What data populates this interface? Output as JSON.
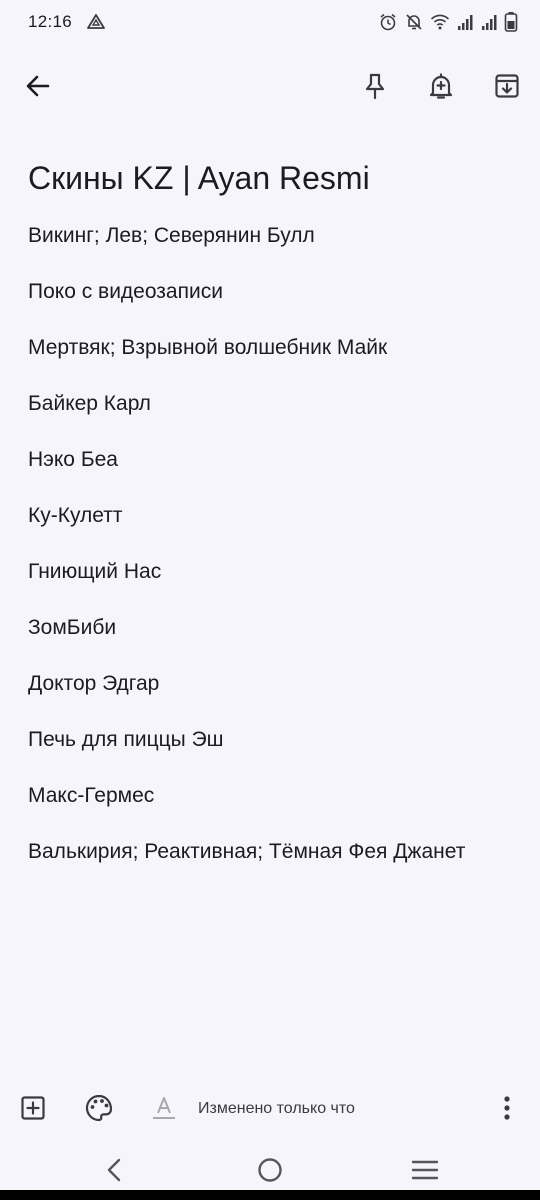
{
  "status_bar": {
    "time": "12:16",
    "icons": [
      "drive-icon",
      "alarm-icon",
      "dnd-off-icon",
      "wifi-icon",
      "signal-icon",
      "signal-icon",
      "battery-icon"
    ]
  },
  "toolbar": {
    "icons": [
      "back-arrow-icon",
      "pin-icon",
      "reminder-bell-icon",
      "archive-icon"
    ]
  },
  "note": {
    "title": "Скины KZ | Ayan Resmi",
    "lines": [
      "Викинг; Лев; Северянин Булл",
      "Поко с видеозаписи",
      "Мертвяк; Взрывной волшебник Майк",
      "Байкер Карл",
      "Нэко Беа",
      "Ку-Кулетт",
      "Гниющий Нас",
      "ЗомБиби",
      "Доктор Эдгар",
      "Печь для пиццы Эш",
      "Макс-Гермес",
      "Валькирия; Реактивная; Тёмная Фея Джанет"
    ]
  },
  "bottom_bar": {
    "status": "Изменено только что",
    "icons": [
      "add-box-icon",
      "palette-icon",
      "text-format-icon",
      "more-vert-icon"
    ]
  },
  "nav_bar": {
    "icons": [
      "nav-back-icon",
      "nav-home-icon",
      "nav-recents-icon"
    ]
  },
  "colors": {
    "background": "#f7f5fc",
    "text": "#1c1b1f",
    "icon": "#3a3a3f"
  }
}
